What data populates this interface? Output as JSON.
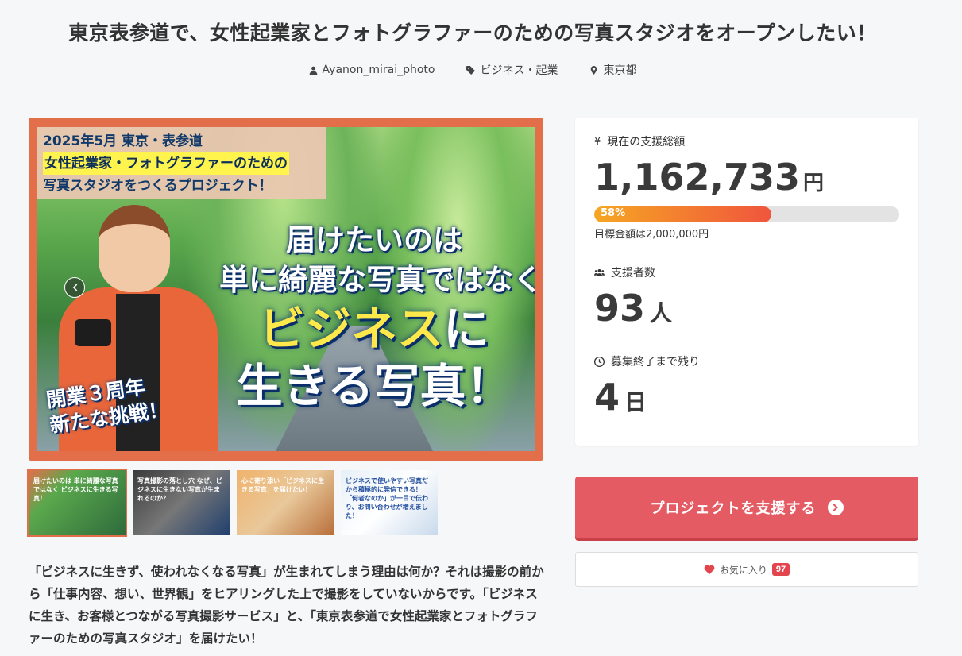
{
  "project": {
    "title": "東京表参道で、女性起業家とフォトグラファーのための写真スタジオをオープンしたい！",
    "author": "Ayanon_mirai_photo",
    "category": "ビジネス・起業",
    "location": "東京都"
  },
  "hero": {
    "tag_lines": [
      "2025年5月 東京・表参道",
      "女性起業家・フォトグラファーのための",
      "写真スタジオをつくるプロジェクト！"
    ],
    "headline_1": "届けたいのは",
    "headline_2": "単に綺麗な写真ではなく",
    "headline_3a": "ビジネス",
    "headline_3b": "に",
    "headline_4": "生きる写真！",
    "anniversary_1": "開業３周年",
    "anniversary_2": "新たな挑戦！"
  },
  "thumbnails": [
    {
      "text": "届けたいのは 単に綺麗な写真ではなく ビジネスに生きる写真！"
    },
    {
      "text": "写真撮影の落とし穴 なぜ、ビジネスに生きない写真が生まれるのか？"
    },
    {
      "text": "心に寄り添い「ビジネスに生きる写真」を届けたい！"
    },
    {
      "text": "ビジネスで使いやすい写真だから積極的に発信できる！「何者なのか」が一目で伝わり、お問い合わせが増えました！"
    }
  ],
  "description": "「ビジネスに生きず、使われなくなる写真」が生まれてしまう理由は何か？それは撮影の前から「仕事内容、想い、世界観」をヒアリングした上で撮影をしていないからです。「ビジネスに生き、お客様とつながる写真撮影サービス」と、「東京表参道で女性起業家とフォトグラファーのための写真スタジオ」を届けたい！",
  "stats": {
    "amount_label": "現在の支援総額",
    "amount": "1,162,733",
    "amount_unit": "円",
    "progress_percent": 58,
    "progress_text": "58%",
    "goal_text": "目標金額は2,000,000円",
    "supporters_label": "支援者数",
    "supporters": "93",
    "supporters_unit": "人",
    "remaining_label": "募集終了まで残り",
    "remaining": "4",
    "remaining_unit": "日"
  },
  "actions": {
    "support_label": "プロジェクトを支援する",
    "favorite_label": "お気に入り",
    "favorite_count": "97"
  },
  "colors": {
    "accent": "#e55b64",
    "hero_frame": "#e36f4a",
    "progress_start": "#f6a623",
    "progress_end": "#f0553d"
  }
}
